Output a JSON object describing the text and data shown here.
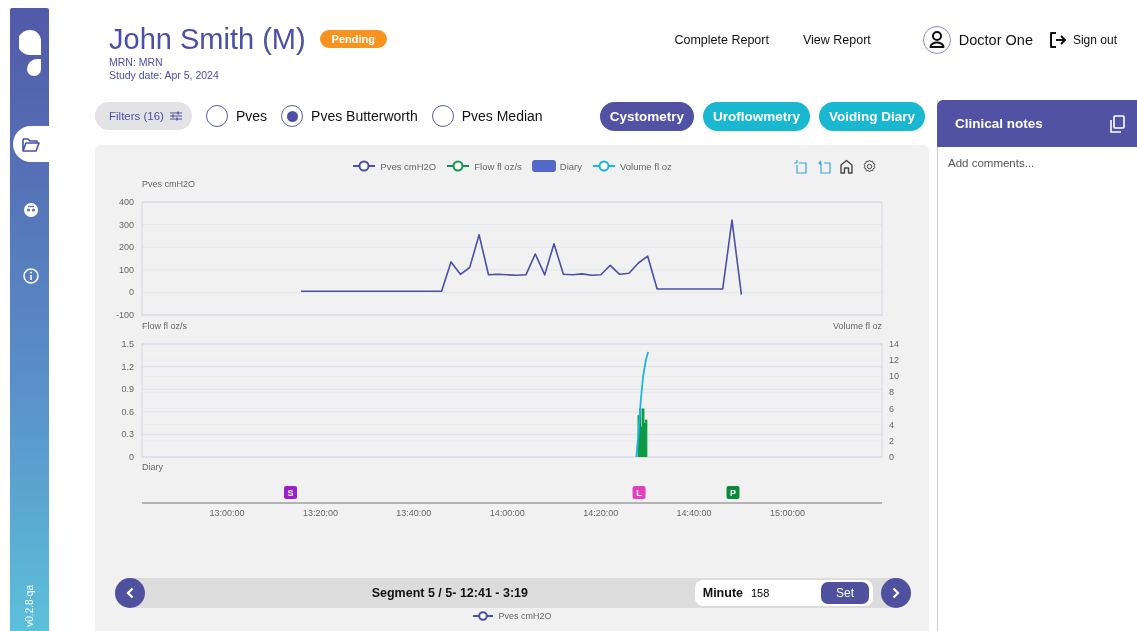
{
  "sidebar": {
    "version": "v0.2.8-qa",
    "items": [
      {
        "kind": "folder",
        "selected": true
      },
      {
        "kind": "face",
        "selected": false
      },
      {
        "kind": "info",
        "selected": false
      }
    ]
  },
  "patient": {
    "name": "John Smith (M)",
    "status": "Pending",
    "mrn": "MRN: MRN",
    "study_date": "Study date: Apr 5, 2024"
  },
  "header_links": [
    "Complete Report",
    "View Report"
  ],
  "user": {
    "name": "Doctor One",
    "sign_out": "Sign out"
  },
  "filters_button": "Filters (16)",
  "signal_options": [
    {
      "label": "Pves",
      "selected": false
    },
    {
      "label": "Pves Butterworth",
      "selected": true
    },
    {
      "label": "Pves Median",
      "selected": false
    }
  ],
  "tabs": [
    {
      "label": "Cystometry",
      "selected": true
    },
    {
      "label": "Uroflowmetry",
      "selected": false
    },
    {
      "label": "Voiding Diary",
      "selected": false
    }
  ],
  "legend": [
    {
      "label": "Pves cmH2O",
      "kind": "line",
      "color": "#4b4fa6"
    },
    {
      "label": "Flow fl oz/s",
      "kind": "line",
      "color": "#0f9a48"
    },
    {
      "label": "Diary",
      "kind": "bar",
      "color": "#5468c8"
    },
    {
      "label": "Volume fl oz",
      "kind": "line",
      "color": "#1cb5e0"
    }
  ],
  "pves_chart": {
    "chart_data": {
      "type": "line",
      "ylabel": "Pves cmH2O",
      "grid": true,
      "ylim": [
        -100,
        400
      ],
      "yticks": [
        -100,
        0,
        100,
        200,
        300,
        400
      ],
      "categories": [
        null,
        null,
        null,
        null,
        null,
        null,
        null,
        null,
        null,
        null,
        null,
        null,
        null,
        null,
        null,
        null,
        null,
        null,
        null,
        null,
        null,
        null,
        null,
        null,
        null,
        null,
        null,
        null,
        null,
        null,
        null,
        null,
        null,
        null,
        null,
        null,
        null,
        null,
        null,
        null,
        null,
        null,
        null,
        null,
        null,
        null,
        null,
        null
      ],
      "series": [
        {
          "color": "#4b4fa6",
          "values": [
            5,
            5,
            5,
            5,
            5,
            5,
            5,
            5,
            5,
            5,
            5,
            5,
            5,
            5,
            5,
            5,
            135,
            80,
            110,
            255,
            78,
            80,
            78,
            76,
            78,
            170,
            78,
            215,
            80,
            78,
            82,
            76,
            78,
            120,
            80,
            85,
            130,
            160,
            15,
            15,
            15,
            15,
            15,
            15,
            15,
            15,
            320,
            -10
          ]
        }
      ]
    }
  },
  "flow_panel": {
    "left_label": "Flow fl oz/s",
    "right_label": "Volume fl oz",
    "left_ticks": [
      "1.5",
      "1.2",
      "0.9",
      "0.6",
      "0.3",
      "0"
    ],
    "right_ticks": [
      "14",
      "12",
      "10",
      "8",
      "6",
      "4",
      "2",
      "0"
    ]
  },
  "diary": {
    "label": "Diary",
    "time_labels": [
      "13:00:00",
      "13:20:00",
      "13:40:00",
      "14:00:00",
      "14:20:00",
      "14:40:00",
      "15:00:00"
    ],
    "events": [
      {
        "text": "S",
        "color": "#9a21c8"
      },
      {
        "text": "L",
        "color": "#e040c0"
      },
      {
        "text": "P",
        "color": "#0a8a3c"
      }
    ]
  },
  "segment_nav": {
    "label": "Segment 5 / 5- 12:41 - 3:19",
    "minute_label": "Minute",
    "minute_value": "158",
    "set_button": "Set"
  },
  "next_legend": "Pves cmH2O",
  "clinical_notes": {
    "title": "Clinical notes",
    "placeholder": "Add comments..."
  }
}
